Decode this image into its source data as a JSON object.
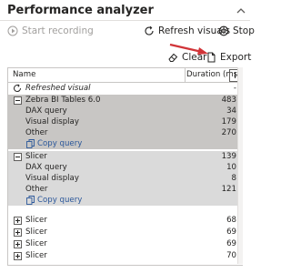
{
  "pane": {
    "title": "Performance analyzer"
  },
  "toolbar": {
    "start_recording": "Start recording",
    "refresh_visuals": "Refresh visuals",
    "stop": "Stop",
    "clear": "Clear",
    "export": "Export"
  },
  "table": {
    "col_name": "Name",
    "col_duration": "Duration (ms)",
    "rows": [
      {
        "name": "Refreshed visual",
        "value": "-"
      },
      {
        "name": "Zebra BI Tables 6.0",
        "value": "483"
      },
      {
        "name": "DAX query",
        "value": "34"
      },
      {
        "name": "Visual display",
        "value": "179"
      },
      {
        "name": "Other",
        "value": "270"
      },
      {
        "name": "Copy query",
        "value": ""
      },
      {
        "name": "Slicer",
        "value": "139"
      },
      {
        "name": "DAX query",
        "value": "10"
      },
      {
        "name": "Visual display",
        "value": "8"
      },
      {
        "name": "Other",
        "value": "121"
      },
      {
        "name": "Copy query",
        "value": ""
      },
      {
        "name": "Slicer",
        "value": "68"
      },
      {
        "name": "Slicer",
        "value": "69"
      },
      {
        "name": "Slicer",
        "value": "69"
      },
      {
        "name": "Slicer",
        "value": "70"
      }
    ]
  },
  "colors": {
    "accent": "#2b579a",
    "highlight": "#c8c6c4",
    "arrow": "#d13438"
  }
}
